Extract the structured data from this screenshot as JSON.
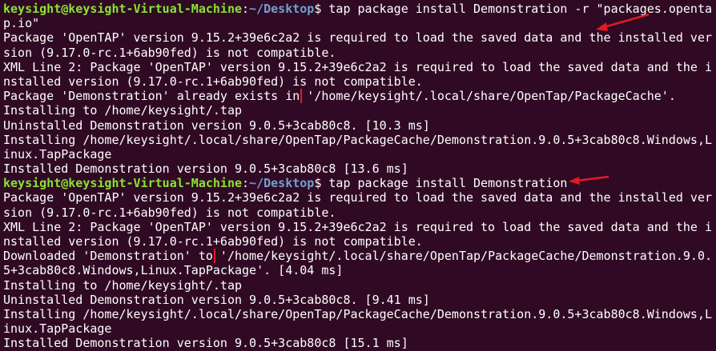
{
  "terminal": {
    "prompt_user_host": "keysight@keysight-Virtual-Machine",
    "prompt_path": "~/Desktop",
    "prompt_suffix": "$ ",
    "cmd1_line1": "tap package install Demonstration -r \"packages.openta",
    "cmd1_line2": "p.io\"",
    "out1": [
      "Package 'OpenTAP' version 9.15.2+39e6c2a2 is required to load the saved data and the installed ver",
      "sion (9.17.0-rc.1+6ab90fed) is not compatible.",
      "XML Line 2: Package 'OpenTAP' version 9.15.2+39e6c2a2 is required to load the saved data and the i",
      "nstalled version (9.17.0-rc.1+6ab90fed) is not compatible."
    ],
    "exists_highlight": "Package 'Demonstration' already exists in",
    "exists_rest": " '/home/keysight/.local/share/OpenTap/PackageCache'.",
    "out2": [
      "Installing to /home/keysight/.tap",
      "Uninstalled Demonstration version 9.0.5+3cab80c8. [10.3 ms]",
      "Installing /home/keysight/.local/share/OpenTap/PackageCache/Demonstration.9.0.5+3cab80c8.Windows,L",
      "inux.TapPackage",
      "Installed Demonstration version 9.0.5+3cab80c8 [13.6 ms]"
    ],
    "cmd2": "tap package install Demonstration",
    "out3": [
      "Package 'OpenTAP' version 9.15.2+39e6c2a2 is required to load the saved data and the installed ver",
      "sion (9.17.0-rc.1+6ab90fed) is not compatible.",
      "XML Line 2: Package 'OpenTAP' version 9.15.2+39e6c2a2 is required to load the saved data and the i",
      "nstalled version (9.17.0-rc.1+6ab90fed) is not compatible."
    ],
    "downloaded_highlight": "Downloaded 'Demonstration' to",
    "downloaded_rest": " '/home/keysight/.local/share/OpenTap/PackageCache/Demonstration.9.0.",
    "downloaded_line2": "5+3cab80c8.Windows,Linux.TapPackage'. [4.04 ms]",
    "out4": [
      "Installing to /home/keysight/.tap",
      "Uninstalled Demonstration version 9.0.5+3cab80c8. [9.41 ms]",
      "Installing /home/keysight/.local/share/OpenTap/PackageCache/Demonstration.9.0.5+3cab80c8.Windows,L",
      "inux.TapPackage",
      "Installed Demonstration version 9.0.5+3cab80c8 [15.1 ms]"
    ]
  },
  "colors": {
    "background": "#300a24",
    "prompt_user": "#8ae234",
    "prompt_path": "#729fcf",
    "annotation": "#e01b24"
  }
}
